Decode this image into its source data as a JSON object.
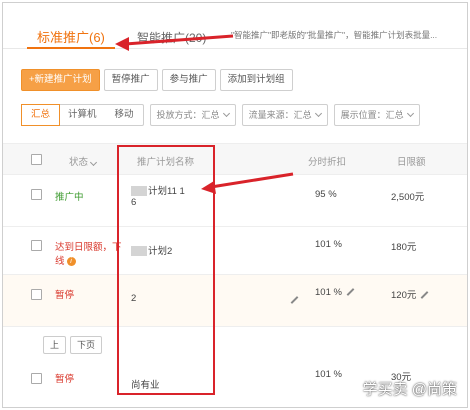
{
  "tabs": [
    {
      "label": "标准推广(6)",
      "active": true
    },
    {
      "label": "智能推广(20)",
      "active": false
    }
  ],
  "tab_note": "\"智能推广\"即老版的\"批量推广\"，智能推广计划表批量...",
  "toolbar": [
    {
      "label": "+新建推广计划",
      "primary": true
    },
    {
      "label": "暂停推广"
    },
    {
      "label": "参与推广"
    },
    {
      "label": "添加到计划组"
    }
  ],
  "filters": {
    "segments": [
      "汇总",
      "计算机",
      "移动"
    ],
    "selects": [
      "投放方式：汇总",
      "流量来源：汇总",
      "展示位置：汇总"
    ]
  },
  "table": {
    "headers": [
      "状态",
      "推广计划名称",
      "分时折扣",
      "日限额"
    ],
    "rows": [
      {
        "status": "推广中",
        "status_color": "#3c9a2e",
        "name": "计划11 1",
        "name_line2": "6",
        "discount": "95 %",
        "budget": "2,500元"
      },
      {
        "status": "达到日限额，下",
        "status_line2": "线",
        "status_color": "#d9382c",
        "name": "计划2",
        "discount": "101 %",
        "budget": "180元"
      },
      {
        "status": "暂停",
        "status_color": "#d9382c",
        "name": "2",
        "discount": "101 %",
        "budget": "120元"
      },
      {
        "status": "暂停",
        "status_color": "#d9382c",
        "name": "尚有业",
        "discount": "101 %",
        "budget": "30元"
      }
    ]
  },
  "pager": [
    "上",
    "下页"
  ],
  "watermark": "学买卖 @尚策",
  "colors": {
    "accent": "#f0730f",
    "annotation": "#d9232a"
  }
}
